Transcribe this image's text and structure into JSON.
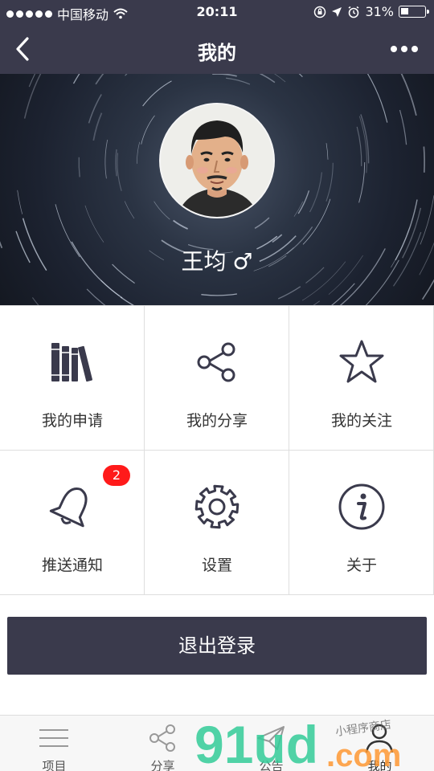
{
  "status_bar": {
    "carrier": "中国移动",
    "time": "20:11",
    "battery": "31%",
    "battery_level": 0.31
  },
  "nav": {
    "title": "我的",
    "back_icon": "chevron-left-icon",
    "more_icon": "more-dots-icon"
  },
  "profile": {
    "name": "王均",
    "gender": "♂"
  },
  "menu": [
    {
      "label": "我的申请",
      "icon": "books-icon"
    },
    {
      "label": "我的分享",
      "icon": "share-icon"
    },
    {
      "label": "我的关注",
      "icon": "star-icon"
    },
    {
      "label": "推送通知",
      "icon": "bell-icon",
      "badge": "2"
    },
    {
      "label": "设置",
      "icon": "gear-icon"
    },
    {
      "label": "关于",
      "icon": "info-icon"
    }
  ],
  "logout": {
    "label": "退出登录"
  },
  "tabs": [
    {
      "label": "项目",
      "icon": "menu-lines-icon"
    },
    {
      "label": "分享",
      "icon": "share-icon"
    },
    {
      "label": "公告",
      "icon": "paper-plane-icon"
    },
    {
      "label": "我的",
      "icon": "user-icon"
    }
  ],
  "watermark": {
    "brand": "91ud",
    "domain": ".com",
    "tagline": "小程序商店"
  },
  "colors": {
    "header_bg": "#3a3a4c",
    "badge": "#ff1a1a",
    "watermark_green": "#33cc99",
    "watermark_orange": "#ff9933"
  }
}
